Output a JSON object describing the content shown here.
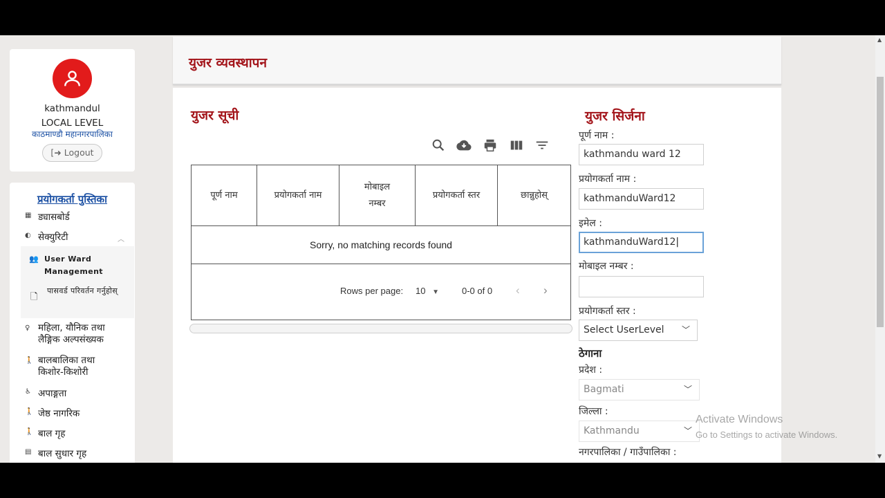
{
  "profile": {
    "name": "kathmandul",
    "level": "LOCAL LEVEL",
    "org": "काठमाण्डौ महानगरपालिका",
    "logout_label": "Logout"
  },
  "sidebar": {
    "title": "प्रयोगकर्ता पुस्तिका",
    "items": [
      {
        "label": "ड्यासबोर्ड",
        "icon": "grid-icon"
      },
      {
        "label": "सेक्युरिटी",
        "icon": "shield-icon"
      },
      {
        "label": "महिला, यौनिक तथा लैङ्गिक अल्पसंख्यक",
        "icon": "female-icon"
      },
      {
        "label": "बालबालिका तथा किशोर-किशोरी",
        "icon": "child-icon"
      },
      {
        "label": "अपाङ्गता",
        "icon": "wheelchair-icon"
      },
      {
        "label": "जेष्ठ नागरिक",
        "icon": "elderly-icon"
      },
      {
        "label": "बाल गृह",
        "icon": "child-icon"
      },
      {
        "label": "बाल सुधार गृह",
        "icon": "building-icon"
      }
    ],
    "sub_items": [
      {
        "label": "User Ward Management",
        "icon": "users-icon"
      },
      {
        "label": "पासवर्ड परिवर्तन गर्नुहोस्",
        "icon": "document-icon"
      }
    ]
  },
  "header": {
    "title": "युजर व्यवस्थापन"
  },
  "user_list": {
    "title": "युजर सूची",
    "columns": [
      "पूर्ण नाम",
      "प्रयोगकर्ता नाम",
      "मोबाइल नम्बर",
      "प्रयोगकर्ता स्तर",
      "छान्नुहोस्"
    ],
    "empty_message": "Sorry, no matching records found",
    "rows_per_page_label": "Rows per page:",
    "rows_per_page_value": "10",
    "range_text": "0-0 of 0",
    "toolbar_icons": [
      "search-icon",
      "download-icon",
      "print-icon",
      "columns-icon",
      "filter-icon"
    ]
  },
  "form": {
    "title": "युजर सिर्जना",
    "full_name_label": "पूर्ण नाम :",
    "full_name_value": "kathmandu ward 12",
    "username_label": "प्रयोगकर्ता नाम :",
    "username_value": "kathmanduWard12",
    "email_label": "इमेल :",
    "email_value": "kathmanduWard12",
    "mobile_label": "मोबाइल नम्बर :",
    "mobile_value": "",
    "userlevel_label": "प्रयोगकर्ता स्तर :",
    "userlevel_value": "Select UserLevel",
    "address_heading": "ठेगाना",
    "province_label": "प्रदेश :",
    "province_value": "Bagmati",
    "district_label": "जिल्ला :",
    "district_value": "Kathmandu",
    "municipality_label": "नगरपालिका / गाउँपालिका :"
  },
  "watermark": {
    "line1": "Activate Windows",
    "line2": "Go to Settings to activate Windows."
  },
  "colors": {
    "accent_red": "#a3141a",
    "avatar_red": "#e21b1b",
    "link_blue": "#1a4fa3"
  }
}
